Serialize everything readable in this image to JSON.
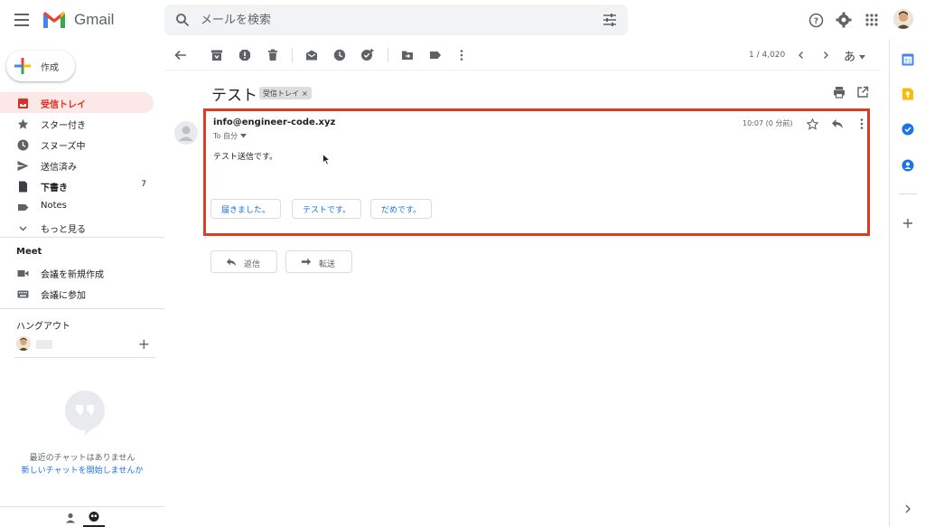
{
  "app": {
    "brand": "Gmail"
  },
  "search": {
    "placeholder": "メールを検索"
  },
  "compose": {
    "label": "作成"
  },
  "nav": [
    {
      "label": "受信トレイ",
      "icon": "inbox-icon",
      "active": true,
      "count": ""
    },
    {
      "label": "スター付き",
      "icon": "star-icon",
      "count": ""
    },
    {
      "label": "スヌーズ中",
      "icon": "clock-icon",
      "count": ""
    },
    {
      "label": "送信済み",
      "icon": "send-icon",
      "count": ""
    },
    {
      "label": "下書き",
      "icon": "draft-icon",
      "bold": true,
      "count": "7"
    },
    {
      "label": "Notes",
      "icon": "label-icon",
      "count": ""
    },
    {
      "label": "もっと見る",
      "icon": "chevron-down-icon",
      "count": ""
    }
  ],
  "meet": {
    "title": "Meet",
    "items": [
      {
        "label": "会議を新規作成",
        "icon": "video-icon"
      },
      {
        "label": "会議に参加",
        "icon": "keyboard-icon"
      }
    ]
  },
  "hangouts": {
    "title": "ハングアウト",
    "empty_text": "最近のチャットはありません",
    "start_link": "新しいチャットを開始しませんか"
  },
  "toolbar": {
    "pager": "1 / 4,020",
    "lang": "あ"
  },
  "message": {
    "subject": "テスト",
    "label_chip": "受信トレイ",
    "label_chip_close": "×",
    "from": "info@engineer-code.xyz",
    "to": "To 自分",
    "time": "10:07 (0 分前)",
    "body": "テスト送信です。",
    "smart_replies": [
      "届きました。",
      "テストです。",
      "だめです。"
    ]
  },
  "actions": {
    "reply": "返信",
    "forward": "転送"
  },
  "colors": {
    "accent_red": "#d93025",
    "highlight_border": "#e03b24",
    "link_blue": "#1a73e8",
    "active_bg": "#fce8e6"
  }
}
